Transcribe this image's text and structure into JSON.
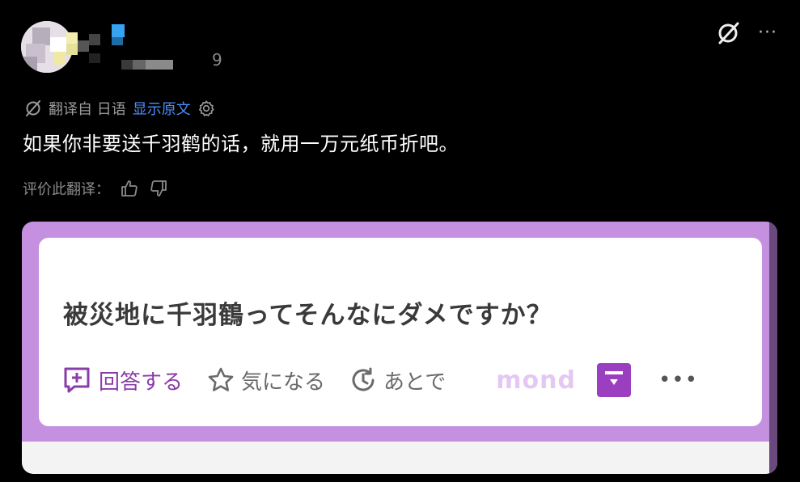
{
  "post": {
    "count": "9"
  },
  "translation": {
    "prefix": "翻译自 日语",
    "show_original": "显示原文",
    "text": "如果你非要送千羽鹤的话，就用一万元纸币折吧。",
    "rate_label": "评价此翻译："
  },
  "icons": {
    "mute": "slashed-circle-icon",
    "more": "more-icon",
    "settings": "gear-icon",
    "thumbs_up": "thumbs-up-icon",
    "thumbs_down": "thumbs-down-icon"
  },
  "more_glyph": "···",
  "image": {
    "question": "被災地に千羽鶴ってそんなにダメですか？",
    "answer_label": "回答する",
    "watch_label": "気になる",
    "later_label": "あとで",
    "watermark": "mond",
    "more_glyph": "•••"
  },
  "colors": {
    "accent_link": "#4a8df8",
    "card_purple": "#c590e0",
    "answer_purple": "#8a3ca8"
  }
}
